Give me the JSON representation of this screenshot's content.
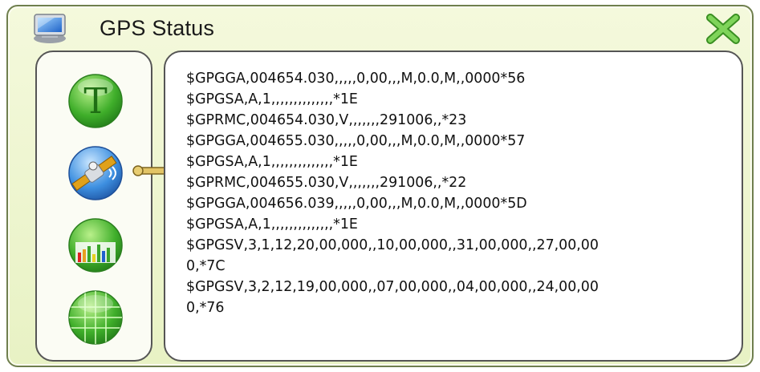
{
  "window": {
    "title": "GPS Status",
    "icons": {
      "app": "computer-icon",
      "close": "close-x-icon"
    }
  },
  "sidebar": {
    "buttons": [
      {
        "id": "text-view",
        "icon": "letter-t-icon",
        "glyph": "T"
      },
      {
        "id": "satellite-view",
        "icon": "satellite-icon"
      },
      {
        "id": "signal-chart-view",
        "icon": "bar-chart-icon"
      },
      {
        "id": "globe-grid-view",
        "icon": "globe-grid-icon"
      }
    ]
  },
  "nmea_log": {
    "lines": [
      "$GPGGA,004654.030,,,,,0,00,,,M,0.0,M,,0000*56",
      "$GPGSA,A,1,,,,,,,,,,,,,,*1E",
      "$GPRMC,004654.030,V,,,,,,,291006,,*23",
      "$GPGGA,004655.030,,,,,0,00,,,M,0.0,M,,0000*57",
      "$GPGSA,A,1,,,,,,,,,,,,,,*1E",
      "$GPRMC,004655.030,V,,,,,,,291006,,*22",
      "$GPGGA,004656.039,,,,,0,00,,,M,0.0,M,,0000*5D",
      "$GPGSA,A,1,,,,,,,,,,,,,,*1E",
      "$GPGSV,3,1,12,20,00,000,,10,00,000,,31,00,000,,27,00,00",
      "0,*7C",
      "$GPGSV,3,2,12,19,00,000,,07,00,000,,04,00,000,,24,00,00",
      "0,*76"
    ]
  },
  "colors": {
    "frame_bg": "#e8f2c4",
    "accent_green": "#3aa52a",
    "close_green": "#58b83a",
    "panel_border": "#555555"
  }
}
